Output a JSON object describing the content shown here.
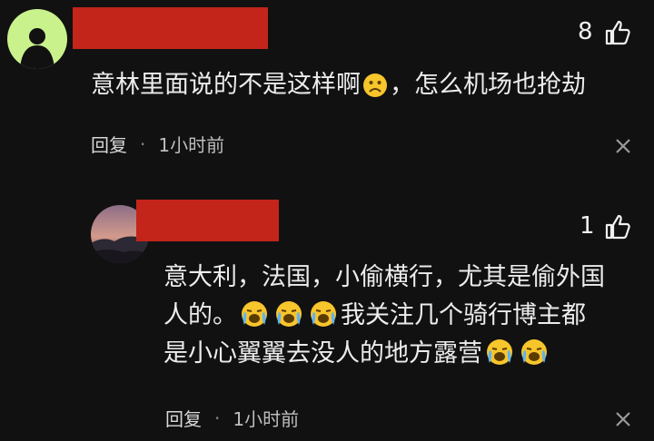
{
  "comment1": {
    "likes": "8",
    "text_part1": "意林里面说的不是这样啊",
    "text_part2": "，怎么机场也抢劫",
    "reply_label": "回复",
    "separator": "·",
    "time": "1小时前"
  },
  "comment2": {
    "likes": "1",
    "line1": "意大利，法国，小偷横行，尤其是偷外国",
    "line2_a": "人的。",
    "line2_b": "我关注几个骑行博主都",
    "line3_a": "是小心翼翼去没人的地方露营",
    "reply_label": "回复",
    "separator": "·",
    "time": "1小时前"
  },
  "colors": {
    "background": "#111111",
    "redaction": "#c3251b",
    "avatar1": "#c9f28c"
  },
  "icons": [
    "thumbs-up-icon",
    "close-icon",
    "frowning-emoji",
    "crying-emoji"
  ]
}
